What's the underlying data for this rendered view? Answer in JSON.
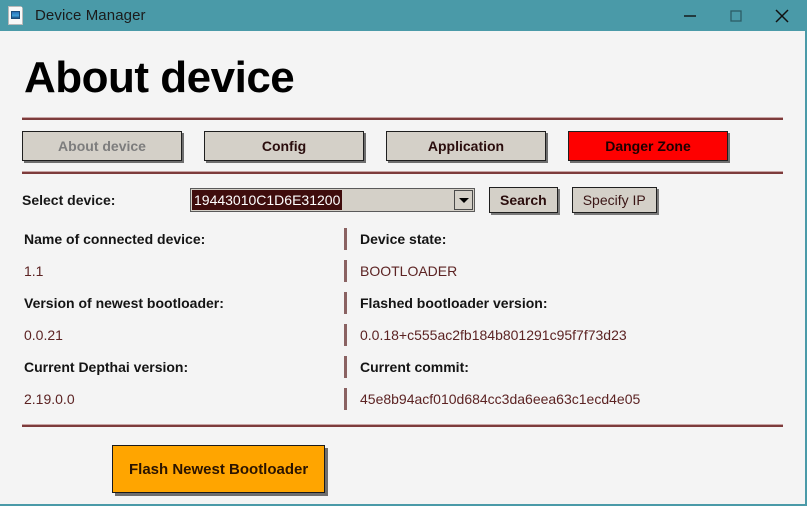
{
  "window": {
    "title": "Device Manager",
    "icon": "document-image-icon",
    "titlebar_color": "#4a9aa8",
    "controls": {
      "minimize": "minimize-icon",
      "maximize": "maximize-icon",
      "close": "close-icon"
    }
  },
  "page": {
    "heading": "About device",
    "accent_color": "#7d3b3b"
  },
  "tabs": [
    {
      "label": "About device",
      "state": "disabled",
      "style": "default"
    },
    {
      "label": "Config",
      "state": "enabled",
      "style": "default"
    },
    {
      "label": "Application",
      "state": "enabled",
      "style": "default"
    },
    {
      "label": "Danger Zone",
      "state": "enabled",
      "style": "danger",
      "color": "#fe0000"
    }
  ],
  "device_select": {
    "label": "Select device:",
    "selected_value": "19443010C1D6E31200",
    "selection_bg": "#3f0d0d",
    "dropdown_icon": "chevron-down-icon",
    "search_button": "Search",
    "specify_ip_button": "Specify IP"
  },
  "info_rows": [
    {
      "left_label": "Name of connected device:",
      "left_value": "1.1",
      "right_label": "Device state:",
      "right_value": "BOOTLOADER"
    },
    {
      "left_label": "Version of newest bootloader:",
      "left_value": "0.0.21",
      "right_label": "Flashed bootloader version:",
      "right_value": "0.0.18+c555ac2fb184b801291c95f7f73d23"
    },
    {
      "left_label": "Current Depthai version:",
      "left_value": "2.19.0.0",
      "right_label": "Current commit:",
      "right_value": "45e8b94acf010d684cc3da6eea63c1ecd4e05"
    }
  ],
  "flash": {
    "button_label": "Flash Newest Bootloader",
    "color": "#ffa500"
  }
}
